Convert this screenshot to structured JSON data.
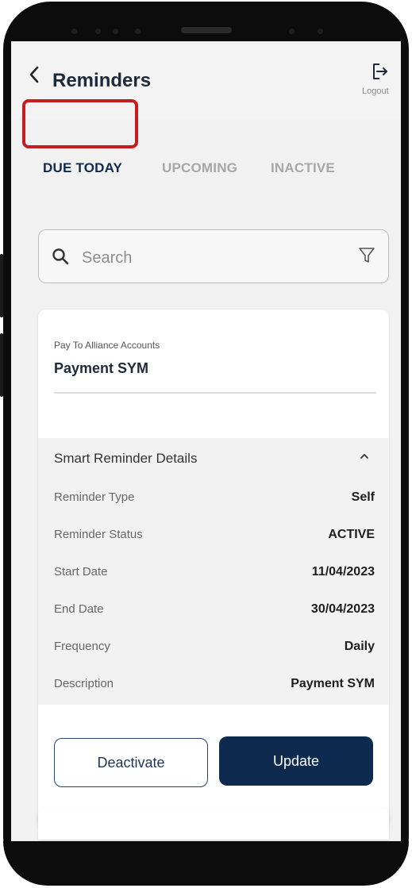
{
  "header": {
    "back_icon": "chevron-left-icon",
    "title": "Reminders",
    "logout_icon": "logout-icon",
    "logout_label": "Logout"
  },
  "tabs": [
    {
      "label": "DUE TODAY",
      "active": true
    },
    {
      "label": "UPCOMING",
      "active": false
    },
    {
      "label": "INACTIVE",
      "active": false
    }
  ],
  "search": {
    "placeholder": "Search",
    "value": "",
    "search_icon": "search-icon",
    "filter_icon": "filter-icon"
  },
  "card": {
    "subtitle": "Pay To Alliance Accounts",
    "name": "Payment SYM",
    "details_title": "Smart Reminder Details",
    "details_toggle_icon": "chevron-up-icon",
    "rows": [
      {
        "label": "Reminder Type",
        "value": "Self"
      },
      {
        "label": "Reminder Status",
        "value": "ACTIVE"
      },
      {
        "label": "Start Date",
        "value": "11/04/2023"
      },
      {
        "label": "End Date",
        "value": "30/04/2023"
      },
      {
        "label": "Frequency",
        "value": "Daily"
      },
      {
        "label": "Description",
        "value": "Payment SYM"
      }
    ],
    "deactivate_label": "Deactivate",
    "update_label": "Update"
  },
  "colors": {
    "primary": "#0f2a4f",
    "highlight": "#c41e1e",
    "inactive_tab": "#a7a7a7"
  }
}
